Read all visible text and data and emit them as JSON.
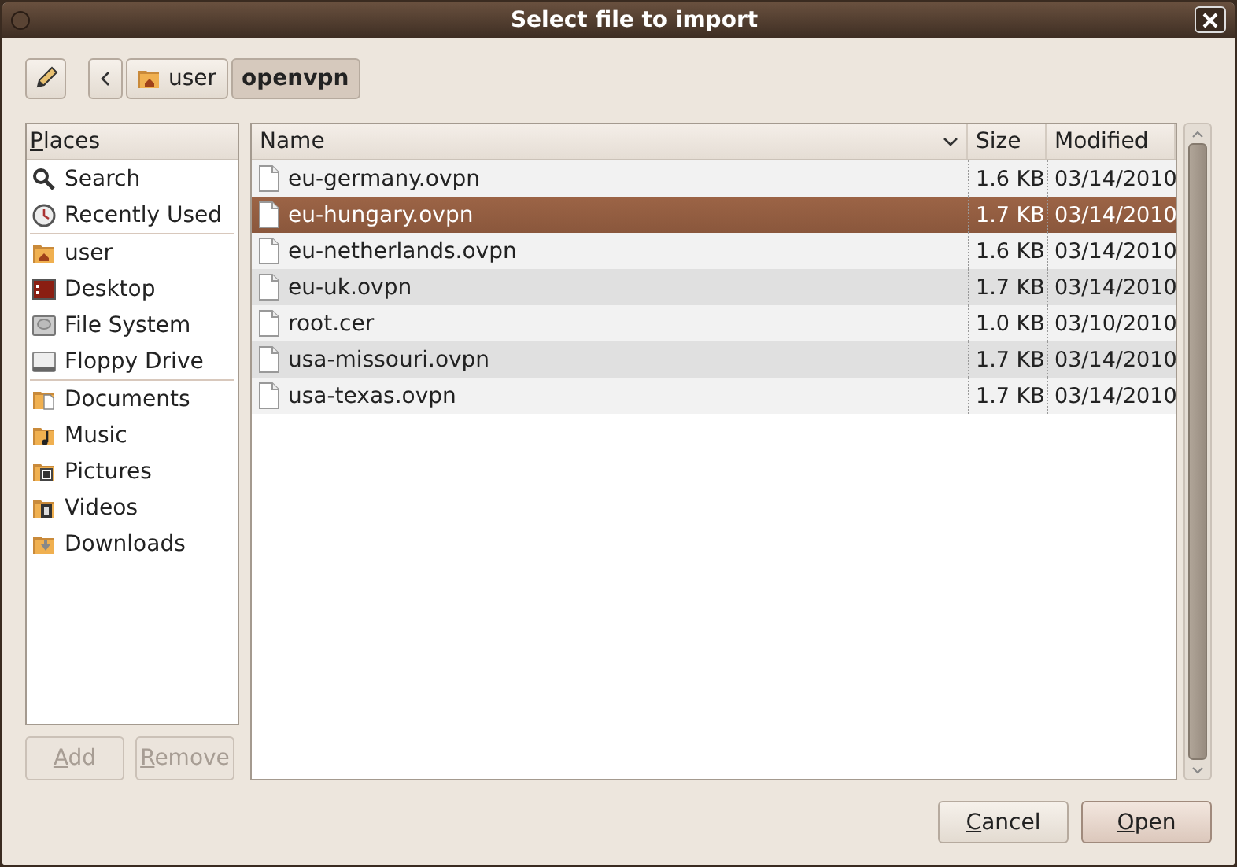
{
  "window": {
    "title": "Select file to import"
  },
  "toolbar": {
    "path": [
      {
        "label": "user",
        "kind": "home",
        "selected": false
      },
      {
        "label": "openvpn",
        "kind": "plain",
        "selected": true
      }
    ]
  },
  "places": {
    "title": "Places",
    "groups": [
      [
        {
          "label": "Search",
          "kind": "search"
        },
        {
          "label": "Recently Used",
          "kind": "recent"
        }
      ],
      [
        {
          "label": "user",
          "kind": "home"
        },
        {
          "label": "Desktop",
          "kind": "desktop"
        },
        {
          "label": "File System",
          "kind": "drive"
        },
        {
          "label": "Floppy Drive",
          "kind": "floppy"
        }
      ],
      [
        {
          "label": "Documents",
          "kind": "documents"
        },
        {
          "label": "Music",
          "kind": "music"
        },
        {
          "label": "Pictures",
          "kind": "pictures"
        },
        {
          "label": "Videos",
          "kind": "videos"
        },
        {
          "label": "Downloads",
          "kind": "downloads"
        }
      ]
    ],
    "buttons": [
      {
        "label": "Add",
        "disabled": true
      },
      {
        "label": "Remove",
        "disabled": true
      }
    ]
  },
  "files": {
    "columns": [
      "Name",
      "Size",
      "Modified"
    ],
    "rows": [
      {
        "name": "eu-germany.ovpn",
        "size": "1.6 KB",
        "modified": "03/14/2010",
        "selected": false
      },
      {
        "name": "eu-hungary.ovpn",
        "size": "1.7 KB",
        "modified": "03/14/2010",
        "selected": true
      },
      {
        "name": "eu-netherlands.ovpn",
        "size": "1.6 KB",
        "modified": "03/14/2010",
        "selected": false
      },
      {
        "name": "eu-uk.ovpn",
        "size": "1.7 KB",
        "modified": "03/14/2010",
        "selected": false
      },
      {
        "name": "root.cer",
        "size": "1.0 KB",
        "modified": "03/10/2010",
        "selected": false
      },
      {
        "name": "usa-missouri.ovpn",
        "size": "1.7 KB",
        "modified": "03/14/2010",
        "selected": false
      },
      {
        "name": "usa-texas.ovpn",
        "size": "1.7 KB",
        "modified": "03/14/2010",
        "selected": false
      }
    ]
  },
  "actions": [
    {
      "label": "Cancel",
      "default": false
    },
    {
      "label": "Open",
      "default": true
    }
  ]
}
